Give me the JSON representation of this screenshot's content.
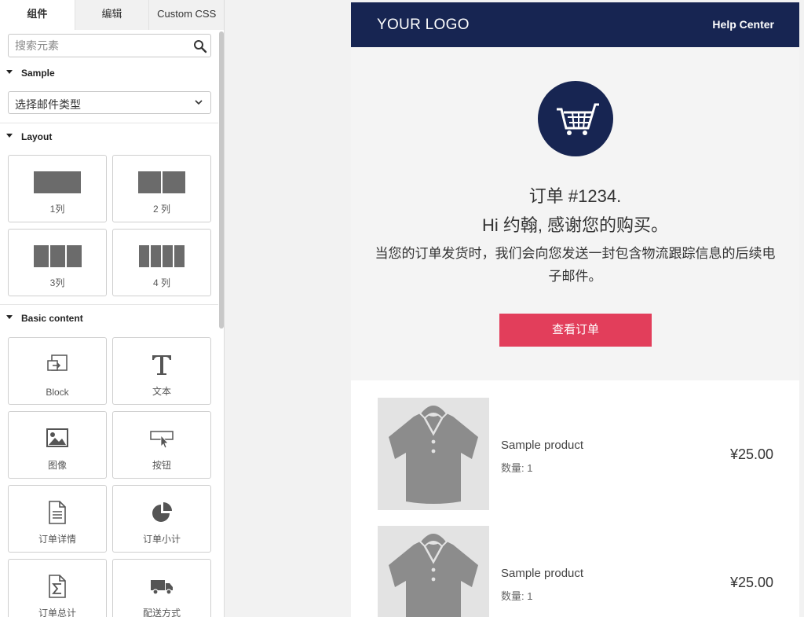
{
  "tabs": [
    {
      "label": "组件",
      "active": true
    },
    {
      "label": "编辑",
      "active": false
    },
    {
      "label": "Custom CSS",
      "active": false
    }
  ],
  "search": {
    "placeholder": "搜索元素",
    "value": ""
  },
  "sections": {
    "sample": {
      "label": "Sample",
      "select_value": "选择邮件类型"
    },
    "layout": {
      "label": "Layout",
      "items": [
        {
          "label": "1列",
          "columns": 1
        },
        {
          "label": "2 列",
          "columns": 2
        },
        {
          "label": "3列",
          "columns": 3
        },
        {
          "label": "4 列",
          "columns": 4
        }
      ]
    },
    "basic": {
      "label": "Basic content",
      "items": [
        {
          "label": "Block",
          "icon": "block-icon"
        },
        {
          "label": "文本",
          "icon": "text-icon"
        },
        {
          "label": "图像",
          "icon": "image-icon"
        },
        {
          "label": "按钮",
          "icon": "button-icon"
        },
        {
          "label": "订单详情",
          "icon": "document-icon"
        },
        {
          "label": "订单小计",
          "icon": "pie-chart-icon"
        },
        {
          "label": "订单总计",
          "icon": "sigma-document-icon"
        },
        {
          "label": "配送方式",
          "icon": "truck-icon"
        }
      ]
    }
  },
  "email": {
    "logo": "YOUR LOGO",
    "help": "Help Center",
    "order_title": "订单 #1234.",
    "greeting": "Hi 约翰, 感谢您的购买。",
    "description": "当您的订单发货时，我们会向您发送一封包含物流跟踪信息的后续电子邮件。",
    "button": "查看订单",
    "products": [
      {
        "name": "Sample product",
        "qty": "数量: 1",
        "price": "¥25.00"
      },
      {
        "name": "Sample product",
        "qty": "数量: 1",
        "price": "¥25.00"
      }
    ]
  },
  "colors": {
    "header": "#172552",
    "button": "#e23e5b",
    "hero_bg": "#f4f4f4"
  }
}
